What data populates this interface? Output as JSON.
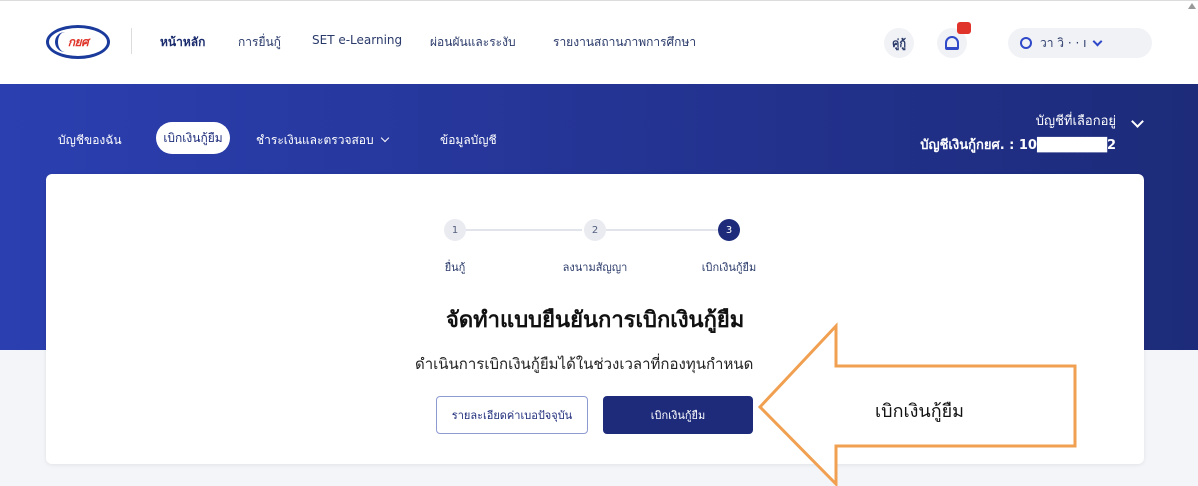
{
  "topnav": {
    "logo_text": "กยศ",
    "links": [
      "หน้าหลัก",
      "การยื่นกู้",
      "SET e-Learning",
      "ผ่อนผันและระงับ",
      "รายงานสถานภาพการศึกษา"
    ],
    "faq_label": "คู่กู้",
    "user_name": "วา  วิ  ·  ·  ı"
  },
  "subnav": {
    "items": [
      "บัญชีของฉัน",
      "เบิกเงินกู้ยืม",
      "ชำระเงินและตรวจสอบ",
      "ข้อมูลบัญชี"
    ],
    "account_title": "บัญชีที่เลือกอยู่",
    "account_number": "บัญชีเงินกู้กยศ. : 10███████2"
  },
  "stepper": {
    "steps": [
      {
        "num": "1",
        "label": "ยื่นกู้"
      },
      {
        "num": "2",
        "label": "ลงนามสัญญา"
      },
      {
        "num": "3",
        "label": "เบิกเงินกู้ยืม"
      }
    ],
    "active_step": 3
  },
  "main": {
    "headline": "จัดทำแบบยืนยันการเบิกเงินกู้ยืม",
    "subline": "ดำเนินการเบิกเงินกู้ยืมได้ในช่วงเวลาที่กองทุนกำหนด",
    "btn_details": "รายละเอียดค่าเบอปัจจุบัน",
    "btn_withdraw": "เบิกเงินกู้ยืม"
  },
  "callout": {
    "text": "เบิกเงินกู้ยืม",
    "color": "#f0a050"
  },
  "colors": {
    "brand_navy": "#1d2b7a",
    "banner_blue": "#2b3fb0",
    "accent_blue": "#2f49c9",
    "badge_red": "#e0342a"
  }
}
